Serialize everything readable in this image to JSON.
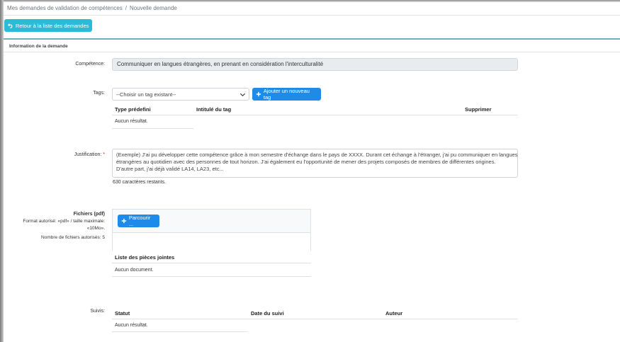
{
  "breadcrumb": {
    "items": [
      "Mes demandes de validation de compétences",
      "Nouvelle demande"
    ],
    "separator": "/"
  },
  "back_button": {
    "label": "Retour à la liste des demandes"
  },
  "card": {
    "title": "Information de la demande"
  },
  "competence": {
    "label": "Compétence:",
    "value": "Communiquer en langues étrangères, en prenant en considération l'interculturalité"
  },
  "tags": {
    "label": "Tags:",
    "select_value": "--Choisir un tag existant--",
    "add_button": "Ajouter un nouveau tag",
    "columns": [
      "Type prédefini",
      "Intitulé du tag",
      "Supprimer"
    ],
    "empty": "Aucun résultat."
  },
  "justification": {
    "label": "Justification:",
    "required_mark": "*",
    "lines": [
      "(Exemple) J'ai pu développer cette compétence grâce à mon semestre d'échange dans le pays de XXXX. Durant cet échange à l'étranger, j'ai pu communiquer en langues",
      "étrangères au quotidien avec des personnes de tout horizon. J'ai également eu l'opportunité de mener des projets composés de membres de différentes origines.",
      "D'autre part, j'ai déjà validé LA14, LA23, etc..."
    ],
    "counter": "630 caractères restants."
  },
  "files": {
    "label": "Fichiers (pdf)",
    "format_line1": "Format autorisé: «pdf» / taille maximale:",
    "format_line2": "«10Mo».",
    "count_note": "Nombre de fichiers autorisés: 5",
    "browse_button": "Parcourir ...",
    "list_header": "Liste des pièces jointes",
    "empty": "Aucun document."
  },
  "suivis": {
    "label": "Suivis:",
    "columns": [
      "Statut",
      "Date du suivi",
      "Auteur"
    ],
    "empty": "Aucun résultat."
  },
  "colors": {
    "info": "#2bbbd6",
    "primary": "#1e8be8",
    "required": "#e02020",
    "card_border": "#6bb0c9"
  }
}
